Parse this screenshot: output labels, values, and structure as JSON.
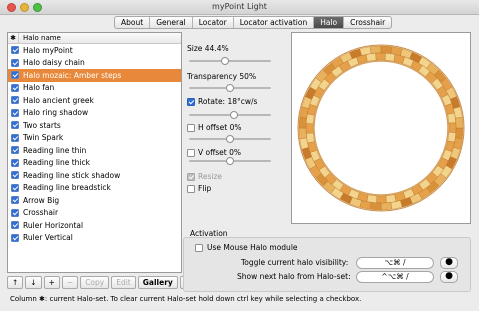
{
  "window": {
    "title": "myPoint Light"
  },
  "tabs": [
    "About",
    "General",
    "Locator",
    "Locator activation",
    "Halo",
    "Crosshair"
  ],
  "selected_tab": "Halo",
  "list": {
    "header_col1": "✱",
    "header_col2": "Halo name",
    "items": [
      "Halo myPoint",
      "Halo daisy chain",
      "Halo mozaic: Amber steps",
      "Halo fan",
      "Halo ancient greek",
      "Halo ring shadow",
      "Two starts",
      "Twin Spark",
      "Reading line thin",
      "Reading line thick",
      "Reading line stick shadow",
      "Reading line breadstick",
      "Arrow Big",
      "Crosshair",
      "Ruler Horizontal",
      "Ruler Vertical"
    ],
    "selected_index": 2
  },
  "list_buttons": {
    "up": "↑",
    "down": "↓",
    "add": "+",
    "remove": "−",
    "copy": "Copy",
    "edit": "Edit",
    "gallery": "Gallery",
    "help": "?"
  },
  "status": "Column ✱: current Halo-set. To clear current Halo-set hold down ctrl key while selecting a checkbox.",
  "settings": {
    "size_label": "Size 44.4%",
    "size_value": 0.444,
    "transparency_label": "Transparency 50%",
    "transparency_value": 0.5,
    "rotate_label": "Rotate: 18°cw/s",
    "rotate_checked": true,
    "rotate_value": 0.55,
    "h_offset_label": "H offset 0%",
    "h_offset_checked": false,
    "h_offset_value": 0.5,
    "v_offset_label": "V offset 0%",
    "v_offset_checked": false,
    "v_offset_value": 0.5,
    "resize_label": "Resize",
    "resize_checked": true,
    "flip_label": "Flip",
    "flip_checked": false
  },
  "activation": {
    "group_label": "Activation",
    "use_mouse_label": "Use Mouse Halo module",
    "toggle_label": "Toggle current halo visibility:",
    "toggle_shortcut": "⌥⌘ /",
    "next_label": "Show next halo from Halo-set:",
    "next_shortcut": "^⌥⌘ /",
    "record_glyph": "●"
  },
  "preview": {
    "colors": [
      "#d9913a",
      "#e8b25c",
      "#f2d48c",
      "#c97b2c",
      "#f0c679",
      "#e5a049"
    ]
  }
}
